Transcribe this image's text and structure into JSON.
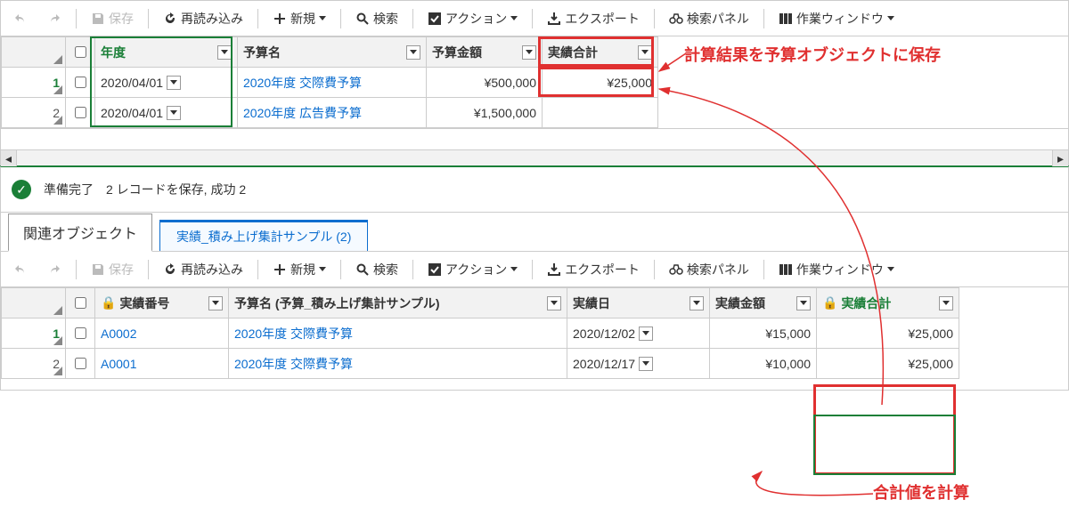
{
  "toolbar": {
    "save": "保存",
    "reload": "再読み込み",
    "new": "新規",
    "search": "検索",
    "action": "アクション",
    "export": "エクスポート",
    "search_panel": "検索パネル",
    "work_window": "作業ウィンドウ"
  },
  "top_grid": {
    "headers": {
      "year": "年度",
      "budget_name": "予算名",
      "budget_amount": "予算金額",
      "actual_total": "実績合計"
    },
    "rows": [
      {
        "num": "1",
        "year": "2020/04/01",
        "name": "2020年度 交際費予算",
        "amount": "¥500,000",
        "total": "¥25,000"
      },
      {
        "num": "2",
        "year": "2020/04/01",
        "name": "2020年度 広告費予算",
        "amount": "¥1,500,000",
        "total": ""
      }
    ]
  },
  "status": {
    "ready": "準備完了",
    "detail": "2 レコードを保存, 成功 2"
  },
  "tabs": {
    "related": "関連オブジェクト",
    "sample": "実績_積み上げ集計サンプル (2)"
  },
  "bottom_grid": {
    "headers": {
      "actual_no": "実績番号",
      "budget_name": "予算名 (予算_積み上げ集計サンプル)",
      "actual_date": "実績日",
      "actual_amount": "実績金額",
      "actual_total": "実績合計"
    },
    "rows": [
      {
        "num": "1",
        "no": "A0002",
        "name": "2020年度 交際費予算",
        "date": "2020/12/02",
        "amount": "¥15,000",
        "total": "¥25,000"
      },
      {
        "num": "2",
        "no": "A0001",
        "name": "2020年度 交際費予算",
        "date": "2020/12/17",
        "amount": "¥10,000",
        "total": "¥25,000"
      }
    ]
  },
  "annotations": {
    "top": "計算結果を予算オブジェクトに保存",
    "bottom": "合計値を計算"
  }
}
